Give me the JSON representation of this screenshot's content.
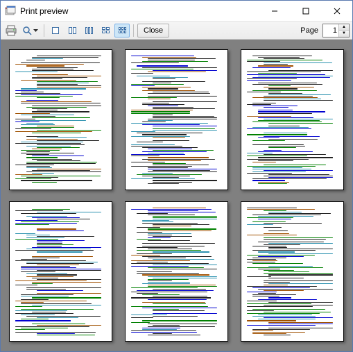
{
  "window": {
    "title": "Print preview"
  },
  "toolbar": {
    "close_label": "Close",
    "page_label": "Page",
    "page_value": "1"
  },
  "preview": {
    "page_count": 6
  }
}
